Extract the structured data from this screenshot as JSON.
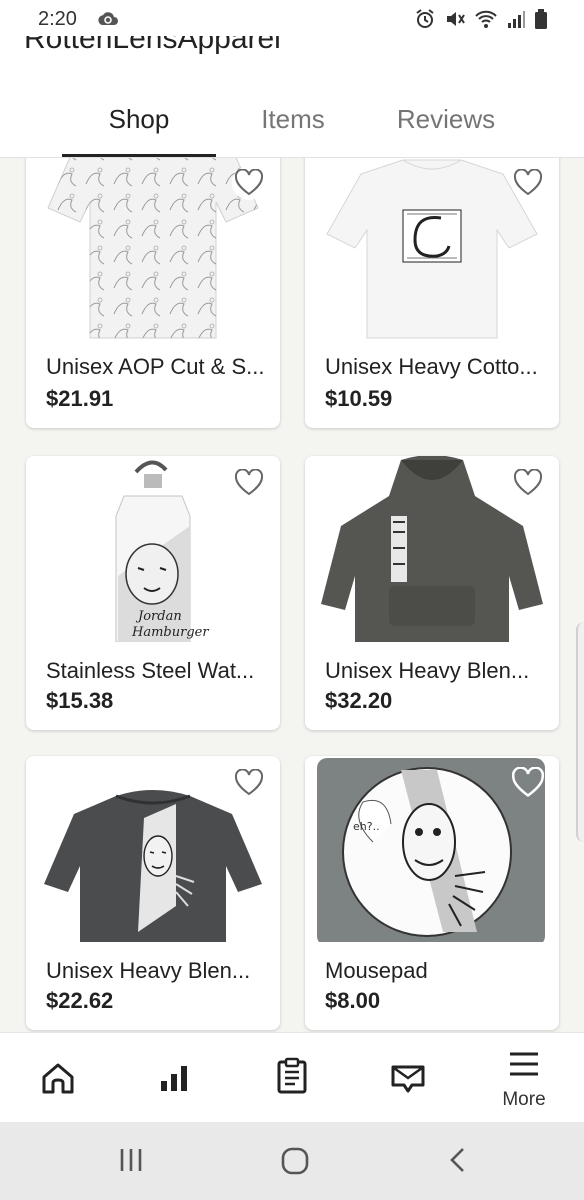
{
  "status_bar": {
    "time": "2:20",
    "icons": [
      "cloud-sync-icon",
      "alarm-icon",
      "mute-icon",
      "wifi-icon",
      "signal-icon",
      "battery-icon"
    ]
  },
  "header": {
    "shop_name": "RottenLensApparel",
    "tabs": [
      {
        "label": "Shop",
        "active": true
      },
      {
        "label": "Items",
        "active": false
      },
      {
        "label": "Reviews",
        "active": false
      }
    ]
  },
  "listings": [
    {
      "title": "Unisex AOP Cut & S...",
      "price": "$21.91",
      "image": "white-patterned-tshirt"
    },
    {
      "title": "Unisex Heavy Cotto...",
      "price": "$10.59",
      "image": "white-tshirt-c-illustration"
    },
    {
      "title": "Stainless Steel Wat...",
      "price": "$15.38",
      "image": "white-water-bottle-jordan-hamburger"
    },
    {
      "title": "Unisex Heavy Blen...",
      "price": "$32.20",
      "image": "charcoal-hoodie"
    },
    {
      "title": "Unisex Heavy Blen...",
      "price": "$22.62",
      "image": "dark-heather-sweatshirt"
    },
    {
      "title": "Mousepad",
      "price": "$8.00",
      "image": "grey-mousepad-face"
    }
  ],
  "bottom_nav": {
    "items": [
      {
        "icon": "home-icon"
      },
      {
        "icon": "stats-icon"
      },
      {
        "icon": "orders-clipboard-icon"
      },
      {
        "icon": "messages-icon"
      },
      {
        "icon": "menu-icon",
        "label": "More"
      }
    ]
  },
  "system_nav": {
    "icons": [
      "recents-icon",
      "home-circle-icon",
      "back-icon"
    ]
  },
  "colors": {
    "background": "#f4f4f1",
    "card": "#ffffff",
    "text": "#222222",
    "muted_tab": "#757575",
    "indicator": "#222222"
  }
}
